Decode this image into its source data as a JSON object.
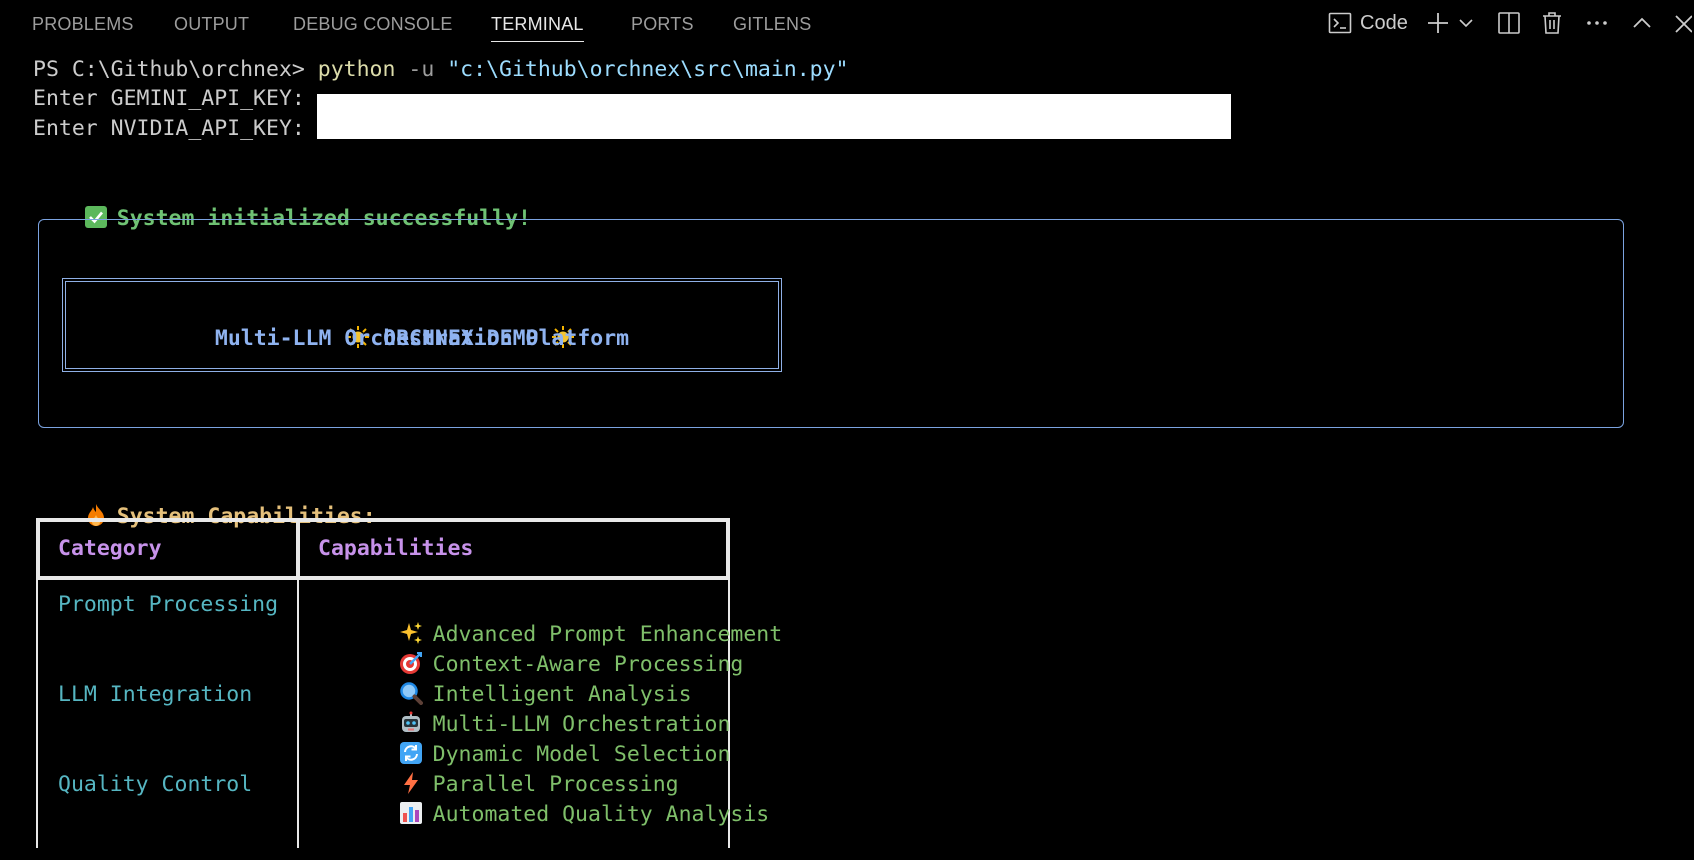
{
  "panel": {
    "tabs": [
      {
        "label": "PROBLEMS"
      },
      {
        "label": "OUTPUT"
      },
      {
        "label": "DEBUG CONSOLE"
      },
      {
        "label": "TERMINAL",
        "active": true
      },
      {
        "label": "PORTS"
      },
      {
        "label": "GITLENS"
      }
    ],
    "terminal_profile": "Code",
    "actions": [
      "terminal-icon",
      "add-icon",
      "chevron-down-icon",
      "split-icon",
      "trash-icon",
      "more-icon",
      "chevron-up-icon",
      "close-icon"
    ]
  },
  "terminal": {
    "prompt": "PS C:\\Github\\orchnex> ",
    "command": "python",
    "flag": " -u ",
    "arg": "\"c:\\Github\\orchnex\\src\\main.py\"",
    "gemini_prompt": "Enter GEMINI_API_KEY: ",
    "nvidia_prompt": "Enter NVIDIA_API_KEY: ",
    "init_message": "System initialized successfully!",
    "banner_title": "ORCHNEX DEMO",
    "banner_subtitle": "Multi-LLM Orchestration Platform",
    "capabilities_heading": "System Capabilities:",
    "table": {
      "headers": [
        "Category",
        "Capabilities"
      ],
      "categories": [
        "Prompt Processing",
        "LLM Integration",
        "Quality Control"
      ],
      "capabilities": [
        {
          "icon": "sparkles-icon",
          "text": "Advanced Prompt Enhancement"
        },
        {
          "icon": "target-icon",
          "text": "Context-Aware Processing"
        },
        {
          "icon": "magnifier-icon",
          "text": "Intelligent Analysis"
        },
        {
          "icon": "robot-icon",
          "text": "Multi-LLM Orchestration"
        },
        {
          "icon": "refresh-icon",
          "text": "Dynamic Model Selection"
        },
        {
          "icon": "lightning-icon",
          "text": "Parallel Processing"
        },
        {
          "icon": "chart-icon",
          "text": "Automated Quality Analysis"
        }
      ]
    }
  },
  "colors": {
    "background": "#000000",
    "accent_tab": "#e7e7e7",
    "success": "#6fc273",
    "banner": "#8fb3f0",
    "header_text": "#c792ea",
    "category_text": "#56b6c2",
    "capability_text": "#7fbf6a"
  }
}
